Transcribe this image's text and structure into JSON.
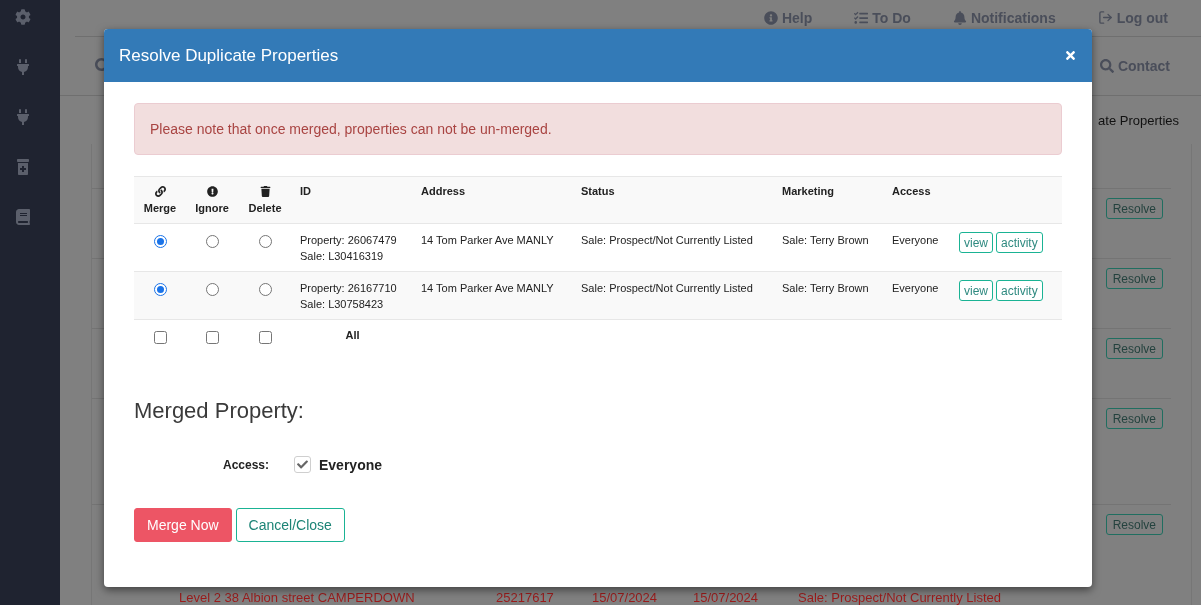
{
  "top_nav": {
    "items": [
      {
        "label": "Help"
      },
      {
        "label": "To Do"
      },
      {
        "label": "Notifications"
      },
      {
        "label": "Log out"
      }
    ]
  },
  "search_bar": {
    "contact": "Contact"
  },
  "page_header": {
    "breadcrumb": "ate Properties"
  },
  "background_rows": [
    {
      "action": "Resolve"
    },
    {
      "action": "Resolve"
    },
    {
      "action": "Resolve"
    },
    {
      "action": "Resolve"
    },
    {
      "action": "Resolve",
      "cells": [
        "Level 2 38 Albion street CAMPERDOWN",
        "25217617",
        "15/07/2024",
        "15/07/2024",
        "Sale: Prospect/Not Currently Listed"
      ]
    }
  ],
  "modal": {
    "title": "Resolve Duplicate Properties",
    "alert": "Please note that once merged, properties can not be un-merged.",
    "table": {
      "action_columns": [
        {
          "label": "Merge"
        },
        {
          "label": "Ignore"
        },
        {
          "label": "Delete"
        }
      ],
      "columns": [
        "ID",
        "Address",
        "Status",
        "Marketing",
        "Access"
      ],
      "rows": [
        {
          "choices": [
            {
              "selected": true
            },
            {
              "selected": false
            },
            {
              "selected": false
            }
          ],
          "property_id": "Property: 26067479",
          "sale_id": "Sale: L30416319",
          "address": "14 Tom Parker Ave MANLY",
          "status": "Sale: Prospect/Not Currently Listed",
          "marketing": "Sale: Terry Brown",
          "access": "Everyone",
          "buttons": [
            "view",
            "activity"
          ]
        },
        {
          "choices": [
            {
              "selected": true
            },
            {
              "selected": false
            },
            {
              "selected": false
            }
          ],
          "property_id": "Property: 26167710",
          "sale_id": "Sale: L30758423",
          "address": "14 Tom Parker Ave MANLY",
          "status": "Sale: Prospect/Not Currently Listed",
          "marketing": "Sale: Terry Brown",
          "access": "Everyone",
          "buttons": [
            "view",
            "activity"
          ]
        }
      ],
      "all_row": {
        "label": "All",
        "checks": [
          {
            "checked": false
          },
          {
            "checked": false
          },
          {
            "checked": false
          }
        ]
      }
    },
    "merged": {
      "heading": "Merged Property:",
      "access_label": "Access:",
      "access_option": {
        "label": "Everyone",
        "checked": true
      }
    },
    "buttons": [
      {
        "label": "Merge Now",
        "kind": "primary"
      },
      {
        "label": "Cancel/Close",
        "kind": "secondary"
      }
    ]
  }
}
